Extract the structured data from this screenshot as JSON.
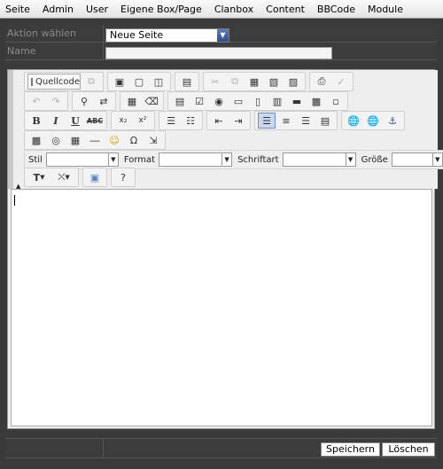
{
  "menu": [
    "Seite",
    "Admin",
    "User",
    "Eigene Box/Page",
    "Clanbox",
    "Content",
    "BBCode",
    "Module"
  ],
  "form": {
    "action_label": "Aktion wählen",
    "action_value": "Neue Seite",
    "name_label": "Name",
    "name_value": ""
  },
  "toolbar": {
    "source_label": "Quellcode",
    "bold": "B",
    "italic": "I",
    "underline": "U",
    "strike": "ABC",
    "subscript": "x₂",
    "superscript": "x²",
    "style_label": "Stil",
    "format_label": "Format",
    "font_label": "Schriftart",
    "size_label": "Größe"
  },
  "buttons": {
    "save": "Speichern",
    "delete": "Löschen"
  },
  "colors": {
    "background": "#3a3a3a",
    "accent": "#2d4f8e"
  }
}
